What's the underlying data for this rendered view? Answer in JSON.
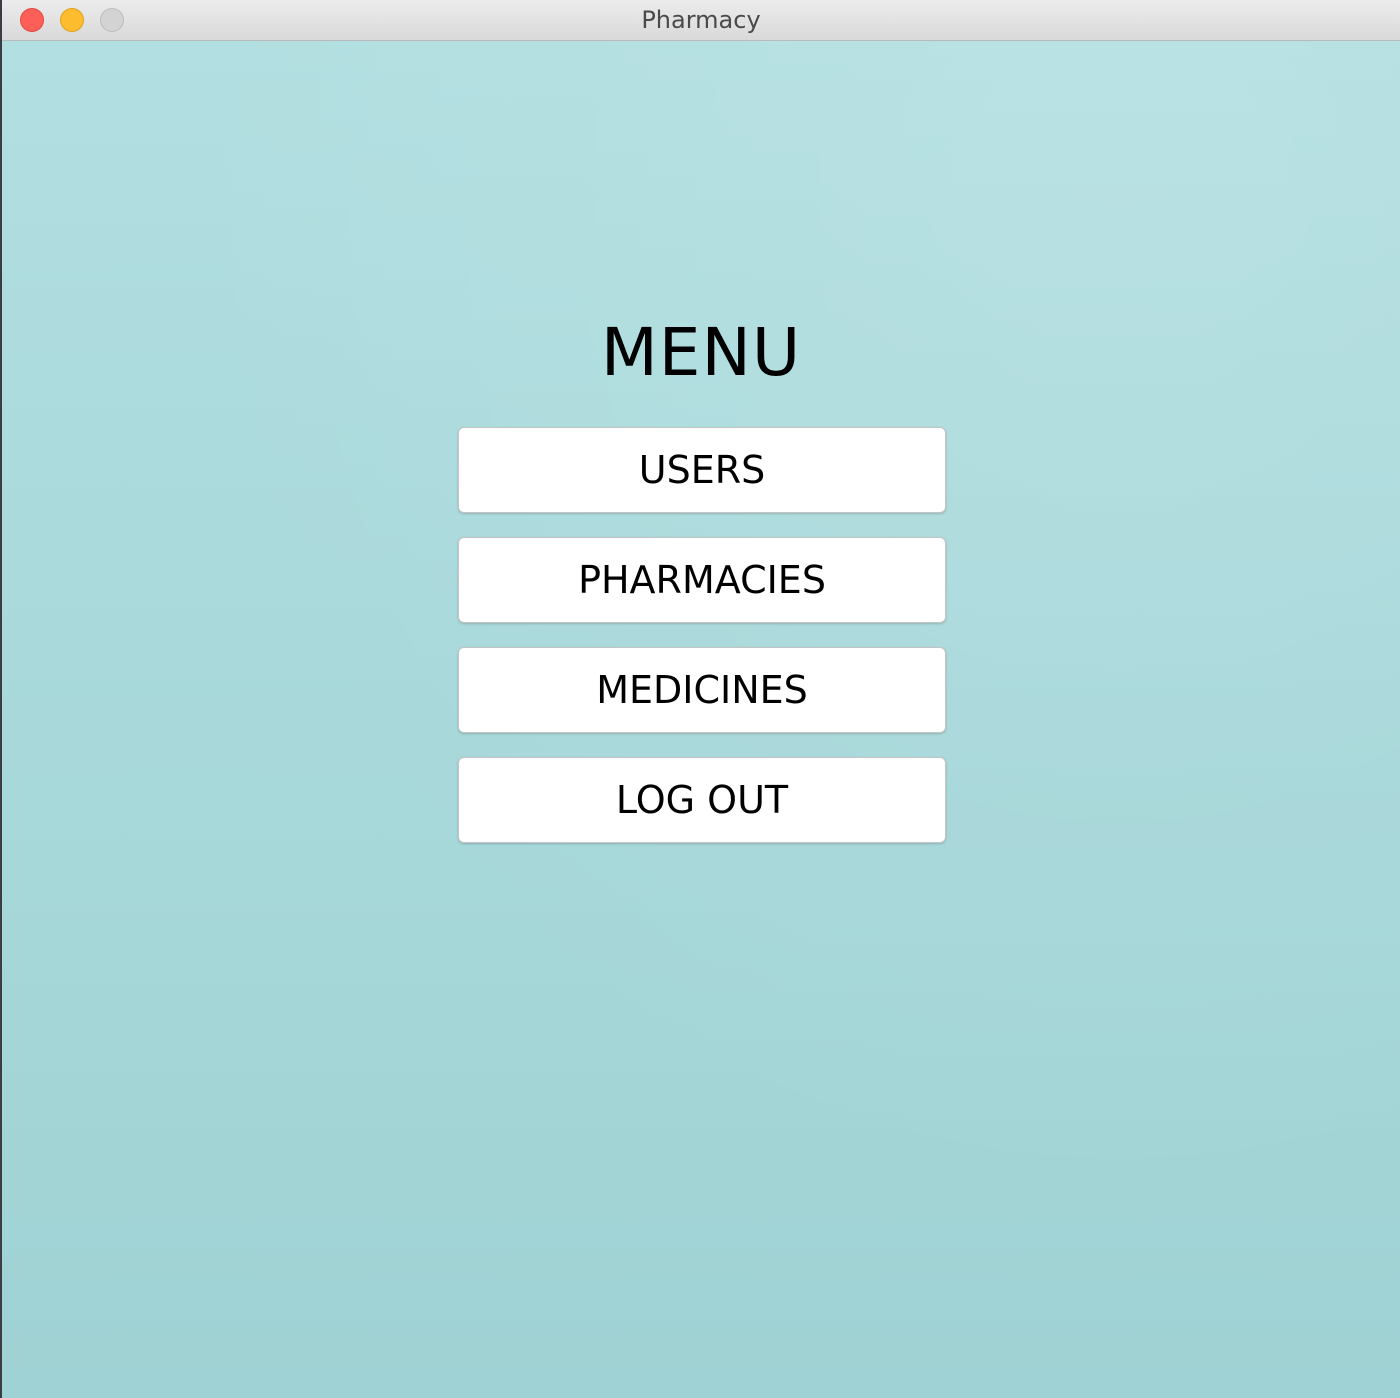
{
  "window": {
    "title": "Pharmacy"
  },
  "menu": {
    "title": "MENU",
    "buttons": [
      {
        "label": "USERS"
      },
      {
        "label": "PHARMACIES"
      },
      {
        "label": "MEDICINES"
      },
      {
        "label": "LOG OUT"
      }
    ]
  },
  "colors": {
    "background": "#a9d9db",
    "button_background": "#ffffff",
    "close": "#fc5f57",
    "minimize": "#fdbc2e",
    "zoom_disabled": "#d3d3d3"
  }
}
